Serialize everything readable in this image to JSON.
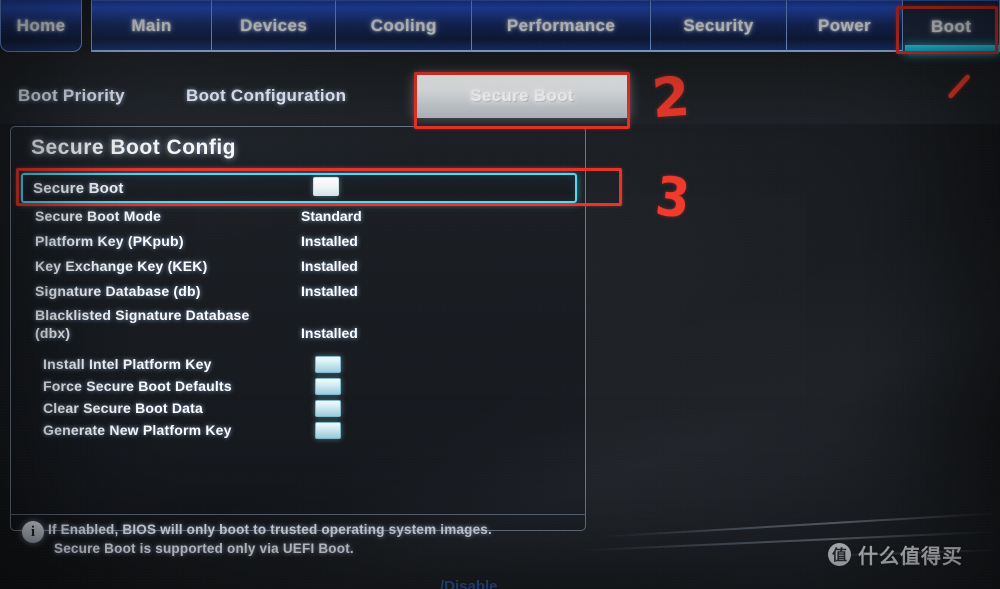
{
  "main_tabs": [
    {
      "label": "Home",
      "active": false
    },
    {
      "label": "Main",
      "active": false
    },
    {
      "label": "Devices",
      "active": false
    },
    {
      "label": "Cooling",
      "active": false
    },
    {
      "label": "Performance",
      "active": false
    },
    {
      "label": "Security",
      "active": false
    },
    {
      "label": "Power",
      "active": false
    },
    {
      "label": "Boot",
      "active": true
    }
  ],
  "sub_tabs": [
    {
      "label": "Boot Priority",
      "selected": false
    },
    {
      "label": "Boot Configuration",
      "selected": false
    },
    {
      "label": "Secure Boot",
      "selected": true
    }
  ],
  "panel": {
    "title": "Secure Boot Config",
    "rows": [
      {
        "label": "Secure Boot",
        "value": "",
        "control": "checkbox",
        "selected": true
      },
      {
        "label": "Secure Boot Mode",
        "value": "Standard",
        "control": "text",
        "selected": false
      },
      {
        "label": "Platform Key (PKpub)",
        "value": "Installed",
        "control": "text",
        "selected": false
      },
      {
        "label": "Key Exchange Key (KEK)",
        "value": "Installed",
        "control": "text",
        "selected": false
      },
      {
        "label": "Signature Database (db)",
        "value": "Installed",
        "control": "text",
        "selected": false
      },
      {
        "label": "Blacklisted Signature Database (dbx)",
        "value": "Installed",
        "control": "text",
        "selected": false,
        "wrap": true
      }
    ],
    "action_rows": [
      {
        "label": "Install Intel Platform Key",
        "control": "checkbox"
      },
      {
        "label": "Force Secure Boot Defaults",
        "control": "checkbox"
      },
      {
        "label": "Clear Secure Boot Data",
        "control": "checkbox"
      },
      {
        "label": "Generate New Platform Key",
        "control": "checkbox"
      }
    ]
  },
  "help": {
    "icon": "info-icon",
    "icon_glyph": "i",
    "line1": "If Enabled, BIOS will only boot to trusted operating system images.",
    "line2": "Secure Boot is supported only via UEFI Boot."
  },
  "annotations": {
    "mark_1": "1",
    "mark_2": "2",
    "mark_3": "3",
    "color": "#ef3a2d"
  },
  "watermark": {
    "logo_glyph": "值",
    "text": "什么值得买"
  },
  "bottom_clip_text": "/Disable",
  "colors": {
    "tab_blue": "#2852cc",
    "active_underline": "#36e6ff",
    "selection_cyan": "#56d8f2",
    "checkbox_fill": "#dcf0f6",
    "annotation_red": "#ef3a2d",
    "panel_bg": "#191d22"
  }
}
